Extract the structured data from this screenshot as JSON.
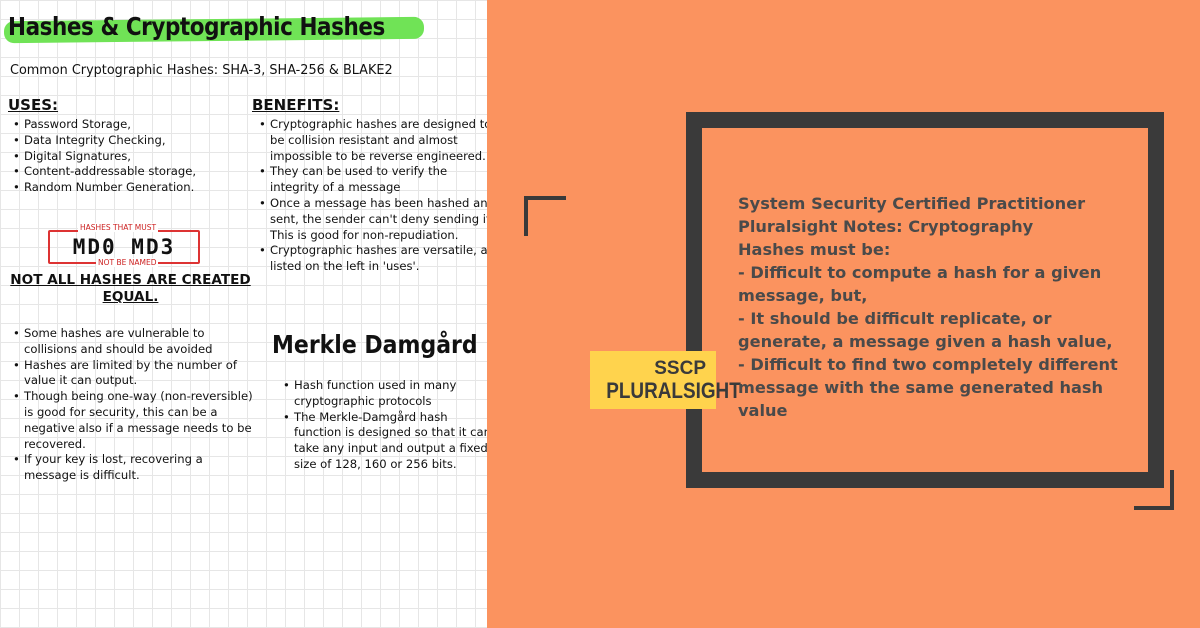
{
  "notes": {
    "title": "Hashes & Cryptographic Hashes",
    "subtitle": "Common Cryptographic Hashes: SHA-3, SHA-256 & BLAKE2",
    "uses": {
      "heading": "USES:",
      "items": [
        "Password Storage,",
        "Data Integrity Checking,",
        "Digital Signatures,",
        "Content-addressable storage,",
        "Random Number Generation."
      ]
    },
    "callout": {
      "top_label": "HASHES THAT MUST",
      "names": "MD0 MD3",
      "bottom_label": "NOT BE NAMED"
    },
    "not_equal": "NOT ALL HASHES ARE CREATED EQUAL.",
    "hashes_notes": {
      "items": [
        "Some hashes are vulnerable to collisions and should be avoided",
        "Hashes are limited by the number of value it can output.",
        "Though being one-way (non-reversible) is good for security, this can be a negative also if a message needs to be recovered.",
        "If your key is lost, recovering a message is difficult."
      ]
    },
    "benefits": {
      "heading": "BENEFITS:",
      "items": [
        "Cryptographic hashes are designed to be collision resistant and almost impossible to be reverse engineered.",
        "They can be used to verify the integrity of a message",
        "Once a message has been hashed and sent, the sender can't deny sending it. This is good for non-repudiation.",
        "Cryptographic hashes are versatile, as listed on the left in 'uses'."
      ]
    },
    "merkle": {
      "heading": "Merkle Damgård",
      "items": [
        "Hash function used in many cryptographic protocols",
        "The Merkle-Damgård hash function is designed so that it can take any input and output a fixed size of 128, 160 or 256 bits."
      ]
    }
  },
  "badge": {
    "line1": "SSCP",
    "line2": "PLURALSIGHT"
  },
  "panel": {
    "lines": [
      "System Security Certified Practitioner",
      "Pluralsight Notes: Cryptography",
      "Hashes must be:",
      "- Difficult to compute a hash for a given message, but,",
      "- It should be difficult replicate, or generate, a message given a hash value,",
      "- Difficult to find two completely different message with the same generated hash value"
    ]
  },
  "colors": {
    "highlight": "#70e356",
    "panel_bg": "#fb935f",
    "frame": "#3a3a3a",
    "badge": "#ffd34d"
  }
}
